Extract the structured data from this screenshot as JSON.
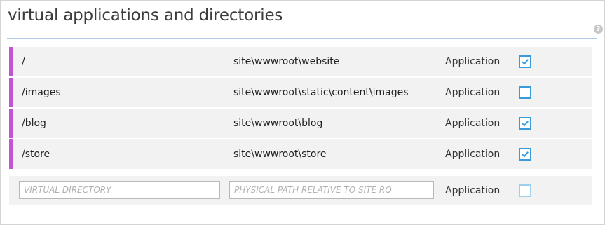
{
  "title": "virtual applications and directories",
  "help_icon": "help-icon",
  "colors": {
    "accent": "#c354d6",
    "checkbox": "#3a9bdc",
    "underline": "#aecbe6",
    "row_background": "#f2f2f2"
  },
  "rows": [
    {
      "directory": "/",
      "path": "site\\wwwroot\\website",
      "type": "Application",
      "checked": true
    },
    {
      "directory": "/images",
      "path": "site\\wwwroot\\static\\content\\images",
      "type": "Application",
      "checked": false
    },
    {
      "directory": "/blog",
      "path": "site\\wwwroot\\blog",
      "type": "Application",
      "checked": true
    },
    {
      "directory": "/store",
      "path": "site\\wwwroot\\store",
      "type": "Application",
      "checked": true
    }
  ],
  "new_row": {
    "directory_placeholder": "VIRTUAL DIRECTORY",
    "directory_value": "",
    "path_placeholder": "PHYSICAL PATH RELATIVE TO SITE RO",
    "path_value": "",
    "type": "Application",
    "checked": false
  }
}
